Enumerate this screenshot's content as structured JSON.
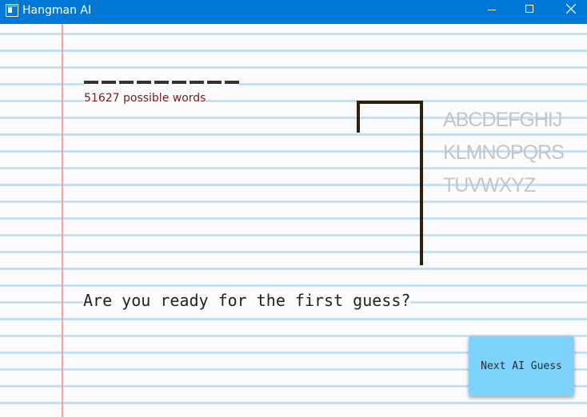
{
  "window": {
    "title": "Hangman AI",
    "controls": [
      "minimize",
      "maximize",
      "close"
    ]
  },
  "game": {
    "word_slots": [
      "",
      "",
      "",
      "",
      "",
      "",
      "",
      "",
      ""
    ],
    "possible_words_text": "51627 possible words",
    "prompt": "Are you ready for the first guess?",
    "alphabet_rows": [
      "ABCDEFGHIJ",
      "KLMNOPQRS",
      "TUVWXYZ"
    ],
    "next_button_label": "Next AI Guess"
  },
  "colors": {
    "titlebar": "#0078d7",
    "margin_line": "#f2a2a6",
    "ruled_line": "#c6dff2",
    "gallows": "#2f1f0f",
    "button": "#7dd3fc",
    "possible_words": "#7a1a1a",
    "alphabet": "#c5c5c5"
  },
  "icons": {
    "app": "app-window-icon",
    "minimize": "minimize-icon",
    "maximize": "maximize-icon",
    "close": "close-icon"
  }
}
